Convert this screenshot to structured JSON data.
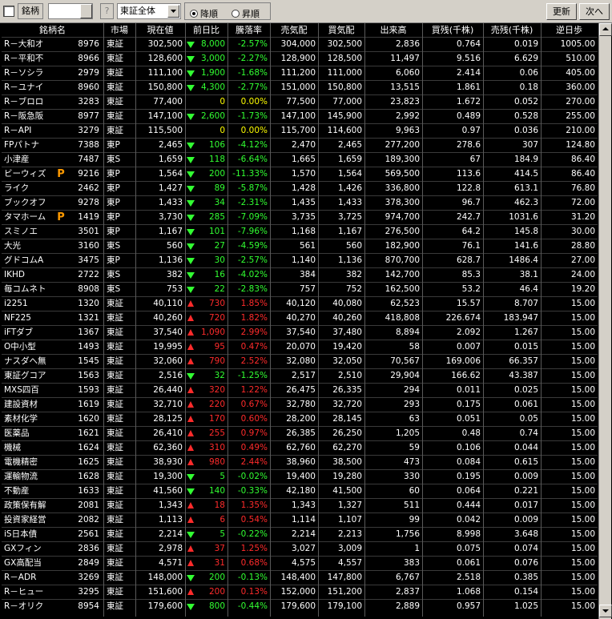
{
  "toolbar": {
    "field_label": "銘柄",
    "code_value": "",
    "help": "?",
    "market_select": "東証全体",
    "sort_desc": "降順",
    "sort_asc": "昇順",
    "refresh_label": "更新",
    "next_label": "次へ"
  },
  "columns": [
    "銘柄名",
    "市場",
    "現在値",
    "前日比",
    "騰落率",
    "売気配",
    "買気配",
    "出来高",
    "買残(千株)",
    "売残(千株)",
    "逆日歩"
  ],
  "rows": [
    {
      "name": "R－大和オ",
      "code": "8976",
      "mkt": "東証",
      "price": "302,500",
      "dir": "down",
      "chg": "8,000",
      "rate": "-2.57%",
      "ask": "304,000",
      "bid": "302,500",
      "vol": "2,836",
      "buy": "0.764",
      "sell": "0.019",
      "gyaku": "1005.00"
    },
    {
      "name": "R－平和不",
      "code": "8966",
      "mkt": "東証",
      "price": "128,600",
      "dir": "down",
      "chg": "3,000",
      "rate": "-2.27%",
      "ask": "128,900",
      "bid": "128,500",
      "vol": "11,497",
      "buy": "9.516",
      "sell": "6.629",
      "gyaku": "510.00"
    },
    {
      "name": "R－ソシラ",
      "code": "2979",
      "mkt": "東証",
      "price": "111,100",
      "dir": "down",
      "chg": "1,900",
      "rate": "-1.68%",
      "ask": "111,200",
      "bid": "111,000",
      "vol": "6,060",
      "buy": "2.414",
      "sell": "0.06",
      "gyaku": "405.00"
    },
    {
      "name": "R－ユナイ",
      "code": "8960",
      "mkt": "東証",
      "price": "150,800",
      "dir": "down",
      "chg": "4,300",
      "rate": "-2.77%",
      "ask": "151,000",
      "bid": "150,800",
      "vol": "13,515",
      "buy": "1.861",
      "sell": "0.18",
      "gyaku": "360.00"
    },
    {
      "name": "R－ブロロ",
      "code": "3283",
      "mkt": "東証",
      "price": "77,400",
      "dir": "flat",
      "chg": "0",
      "rate": "0.00%",
      "ask": "77,500",
      "bid": "77,000",
      "vol": "23,823",
      "buy": "1.672",
      "sell": "0.052",
      "gyaku": "270.00"
    },
    {
      "name": "R－阪急阪",
      "code": "8977",
      "mkt": "東証",
      "price": "147,100",
      "dir": "down",
      "chg": "2,600",
      "rate": "-1.73%",
      "ask": "147,100",
      "bid": "145,900",
      "vol": "2,992",
      "buy": "0.489",
      "sell": "0.528",
      "gyaku": "255.00"
    },
    {
      "name": "R－API",
      "code": "3279",
      "mkt": "東証",
      "price": "115,500",
      "dir": "flat",
      "chg": "0",
      "rate": "0.00%",
      "ask": "115,700",
      "bid": "114,600",
      "vol": "9,963",
      "buy": "0.97",
      "sell": "0.036",
      "gyaku": "210.00"
    },
    {
      "name": "FPパトナ",
      "code": "7388",
      "mkt": "東P",
      "price": "2,465",
      "dir": "down",
      "chg": "106",
      "rate": "-4.12%",
      "ask": "2,470",
      "bid": "2,465",
      "vol": "277,200",
      "buy": "278.6",
      "sell": "307",
      "gyaku": "124.80"
    },
    {
      "name": "小津産",
      "code": "7487",
      "mkt": "東S",
      "price": "1,659",
      "dir": "down",
      "chg": "118",
      "rate": "-6.64%",
      "ask": "1,665",
      "bid": "1,659",
      "vol": "189,300",
      "buy": "67",
      "sell": "184.9",
      "gyaku": "86.40"
    },
    {
      "name": "ビーウィズ",
      "code": "9216",
      "mkt": "東P",
      "price": "1,564",
      "dir": "down",
      "chg": "200",
      "rate": "-11.33%",
      "ask": "1,570",
      "bid": "1,564",
      "vol": "569,500",
      "buy": "113.6",
      "sell": "414.5",
      "gyaku": "86.40",
      "badge": "P"
    },
    {
      "name": "ライク",
      "code": "2462",
      "mkt": "東P",
      "price": "1,427",
      "dir": "down",
      "chg": "89",
      "rate": "-5.87%",
      "ask": "1,428",
      "bid": "1,426",
      "vol": "336,800",
      "buy": "122.8",
      "sell": "613.1",
      "gyaku": "76.80"
    },
    {
      "name": "ブックオフ",
      "code": "9278",
      "mkt": "東P",
      "price": "1,433",
      "dir": "down",
      "chg": "34",
      "rate": "-2.31%",
      "ask": "1,435",
      "bid": "1,433",
      "vol": "378,300",
      "buy": "96.7",
      "sell": "462.3",
      "gyaku": "72.00"
    },
    {
      "name": "タマホーム",
      "code": "1419",
      "mkt": "東P",
      "price": "3,730",
      "dir": "down",
      "chg": "285",
      "rate": "-7.09%",
      "ask": "3,735",
      "bid": "3,725",
      "vol": "974,700",
      "buy": "242.7",
      "sell": "1031.6",
      "gyaku": "31.20",
      "badge": "P"
    },
    {
      "name": "スミノエ",
      "code": "3501",
      "mkt": "東P",
      "price": "1,167",
      "dir": "down",
      "chg": "101",
      "rate": "-7.96%",
      "ask": "1,168",
      "bid": "1,167",
      "vol": "276,500",
      "buy": "64.2",
      "sell": "145.8",
      "gyaku": "30.00"
    },
    {
      "name": "大光",
      "code": "3160",
      "mkt": "東S",
      "price": "560",
      "dir": "down",
      "chg": "27",
      "rate": "-4.59%",
      "ask": "561",
      "bid": "560",
      "vol": "182,900",
      "buy": "76.1",
      "sell": "141.6",
      "gyaku": "28.80"
    },
    {
      "name": "グドコムA",
      "code": "3475",
      "mkt": "東P",
      "price": "1,136",
      "dir": "down",
      "chg": "30",
      "rate": "-2.57%",
      "ask": "1,140",
      "bid": "1,136",
      "vol": "870,700",
      "buy": "628.7",
      "sell": "1486.4",
      "gyaku": "27.00"
    },
    {
      "name": "IKHD",
      "code": "2722",
      "mkt": "東S",
      "price": "382",
      "dir": "down",
      "chg": "16",
      "rate": "-4.02%",
      "ask": "384",
      "bid": "382",
      "vol": "142,700",
      "buy": "85.3",
      "sell": "38.1",
      "gyaku": "24.00"
    },
    {
      "name": "毎コムネト",
      "code": "8908",
      "mkt": "東S",
      "price": "753",
      "dir": "down",
      "chg": "22",
      "rate": "-2.83%",
      "ask": "757",
      "bid": "752",
      "vol": "162,500",
      "buy": "53.2",
      "sell": "46.4",
      "gyaku": "19.20"
    },
    {
      "name": "i2251",
      "code": "1320",
      "mkt": "東証",
      "price": "40,110",
      "dir": "up",
      "chg": "730",
      "rate": "1.85%",
      "ask": "40,120",
      "bid": "40,080",
      "vol": "62,523",
      "buy": "15.57",
      "sell": "8.707",
      "gyaku": "15.00"
    },
    {
      "name": "NF225",
      "code": "1321",
      "mkt": "東証",
      "price": "40,260",
      "dir": "up",
      "chg": "720",
      "rate": "1.82%",
      "ask": "40,270",
      "bid": "40,260",
      "vol": "418,808",
      "buy": "226.674",
      "sell": "183.947",
      "gyaku": "15.00"
    },
    {
      "name": "iFTダブ",
      "code": "1367",
      "mkt": "東証",
      "price": "37,540",
      "dir": "up",
      "chg": "1,090",
      "rate": "2.99%",
      "ask": "37,540",
      "bid": "37,480",
      "vol": "8,894",
      "buy": "2.092",
      "sell": "1.267",
      "gyaku": "15.00"
    },
    {
      "name": "O中小型",
      "code": "1493",
      "mkt": "東証",
      "price": "19,995",
      "dir": "up",
      "chg": "95",
      "rate": "0.47%",
      "ask": "20,070",
      "bid": "19,420",
      "vol": "58",
      "buy": "0.007",
      "sell": "0.015",
      "gyaku": "15.00"
    },
    {
      "name": "ナスダへ無",
      "code": "1545",
      "mkt": "東証",
      "price": "32,060",
      "dir": "up",
      "chg": "790",
      "rate": "2.52%",
      "ask": "32,080",
      "bid": "32,050",
      "vol": "70,567",
      "buy": "169.006",
      "sell": "66.357",
      "gyaku": "15.00"
    },
    {
      "name": "東証グコア",
      "code": "1563",
      "mkt": "東証",
      "price": "2,516",
      "dir": "down",
      "chg": "32",
      "rate": "-1.25%",
      "ask": "2,517",
      "bid": "2,510",
      "vol": "29,904",
      "buy": "166.62",
      "sell": "43.387",
      "gyaku": "15.00"
    },
    {
      "name": "MXS四百",
      "code": "1593",
      "mkt": "東証",
      "price": "26,440",
      "dir": "up",
      "chg": "320",
      "rate": "1.22%",
      "ask": "26,475",
      "bid": "26,335",
      "vol": "294",
      "buy": "0.011",
      "sell": "0.025",
      "gyaku": "15.00"
    },
    {
      "name": "建設資材",
      "code": "1619",
      "mkt": "東証",
      "price": "32,710",
      "dir": "up",
      "chg": "220",
      "rate": "0.67%",
      "ask": "32,780",
      "bid": "32,720",
      "vol": "293",
      "buy": "0.175",
      "sell": "0.061",
      "gyaku": "15.00"
    },
    {
      "name": "素材化学",
      "code": "1620",
      "mkt": "東証",
      "price": "28,125",
      "dir": "up",
      "chg": "170",
      "rate": "0.60%",
      "ask": "28,200",
      "bid": "28,145",
      "vol": "63",
      "buy": "0.051",
      "sell": "0.05",
      "gyaku": "15.00"
    },
    {
      "name": "医薬品",
      "code": "1621",
      "mkt": "東証",
      "price": "26,410",
      "dir": "up",
      "chg": "255",
      "rate": "0.97%",
      "ask": "26,385",
      "bid": "26,250",
      "vol": "1,205",
      "buy": "0.48",
      "sell": "0.74",
      "gyaku": "15.00"
    },
    {
      "name": "機械",
      "code": "1624",
      "mkt": "東証",
      "price": "62,360",
      "dir": "up",
      "chg": "310",
      "rate": "0.49%",
      "ask": "62,760",
      "bid": "62,270",
      "vol": "59",
      "buy": "0.106",
      "sell": "0.044",
      "gyaku": "15.00"
    },
    {
      "name": "電機精密",
      "code": "1625",
      "mkt": "東証",
      "price": "38,930",
      "dir": "up",
      "chg": "980",
      "rate": "2.44%",
      "ask": "38,960",
      "bid": "38,500",
      "vol": "473",
      "buy": "0.084",
      "sell": "0.615",
      "gyaku": "15.00"
    },
    {
      "name": "運輸物流",
      "code": "1628",
      "mkt": "東証",
      "price": "19,300",
      "dir": "down",
      "chg": "5",
      "rate": "-0.02%",
      "ask": "19,400",
      "bid": "19,280",
      "vol": "330",
      "buy": "0.195",
      "sell": "0.009",
      "gyaku": "15.00"
    },
    {
      "name": "不動産",
      "code": "1633",
      "mkt": "東証",
      "price": "41,560",
      "dir": "down",
      "chg": "140",
      "rate": "-0.33%",
      "ask": "42,180",
      "bid": "41,500",
      "vol": "60",
      "buy": "0.064",
      "sell": "0.221",
      "gyaku": "15.00"
    },
    {
      "name": "政策保有解",
      "code": "2081",
      "mkt": "東証",
      "price": "1,343",
      "dir": "up",
      "chg": "18",
      "rate": "1.35%",
      "ask": "1,343",
      "bid": "1,327",
      "vol": "511",
      "buy": "0.444",
      "sell": "0.017",
      "gyaku": "15.00"
    },
    {
      "name": "投資家経営",
      "code": "2082",
      "mkt": "東証",
      "price": "1,113",
      "dir": "up",
      "chg": "6",
      "rate": "0.54%",
      "ask": "1,114",
      "bid": "1,107",
      "vol": "99",
      "buy": "0.042",
      "sell": "0.009",
      "gyaku": "15.00"
    },
    {
      "name": "iS日本債",
      "code": "2561",
      "mkt": "東証",
      "price": "2,214",
      "dir": "down",
      "chg": "5",
      "rate": "-0.22%",
      "ask": "2,214",
      "bid": "2,213",
      "vol": "1,756",
      "buy": "8.998",
      "sell": "3.648",
      "gyaku": "15.00"
    },
    {
      "name": "GXフィン",
      "code": "2836",
      "mkt": "東証",
      "price": "2,978",
      "dir": "up",
      "chg": "37",
      "rate": "1.25%",
      "ask": "3,027",
      "bid": "3,009",
      "vol": "1",
      "buy": "0.075",
      "sell": "0.074",
      "gyaku": "15.00"
    },
    {
      "name": "GX高配当",
      "code": "2849",
      "mkt": "東証",
      "price": "4,571",
      "dir": "up",
      "chg": "31",
      "rate": "0.68%",
      "ask": "4,575",
      "bid": "4,557",
      "vol": "383",
      "buy": "0.061",
      "sell": "0.076",
      "gyaku": "15.00"
    },
    {
      "name": "R－ADR",
      "code": "3269",
      "mkt": "東証",
      "price": "148,000",
      "dir": "down",
      "chg": "200",
      "rate": "-0.13%",
      "ask": "148,400",
      "bid": "147,800",
      "vol": "6,767",
      "buy": "2.518",
      "sell": "0.385",
      "gyaku": "15.00"
    },
    {
      "name": "R－ヒュー",
      "code": "3295",
      "mkt": "東証",
      "price": "151,600",
      "dir": "up",
      "chg": "200",
      "rate": "0.13%",
      "ask": "152,000",
      "bid": "151,200",
      "vol": "2,837",
      "buy": "1.068",
      "sell": "0.154",
      "gyaku": "15.00"
    },
    {
      "name": "R－オリク",
      "code": "8954",
      "mkt": "東証",
      "price": "179,600",
      "dir": "down",
      "chg": "800",
      "rate": "-0.44%",
      "ask": "179,600",
      "bid": "179,100",
      "vol": "2,889",
      "buy": "0.957",
      "sell": "1.025",
      "gyaku": "15.00"
    }
  ]
}
